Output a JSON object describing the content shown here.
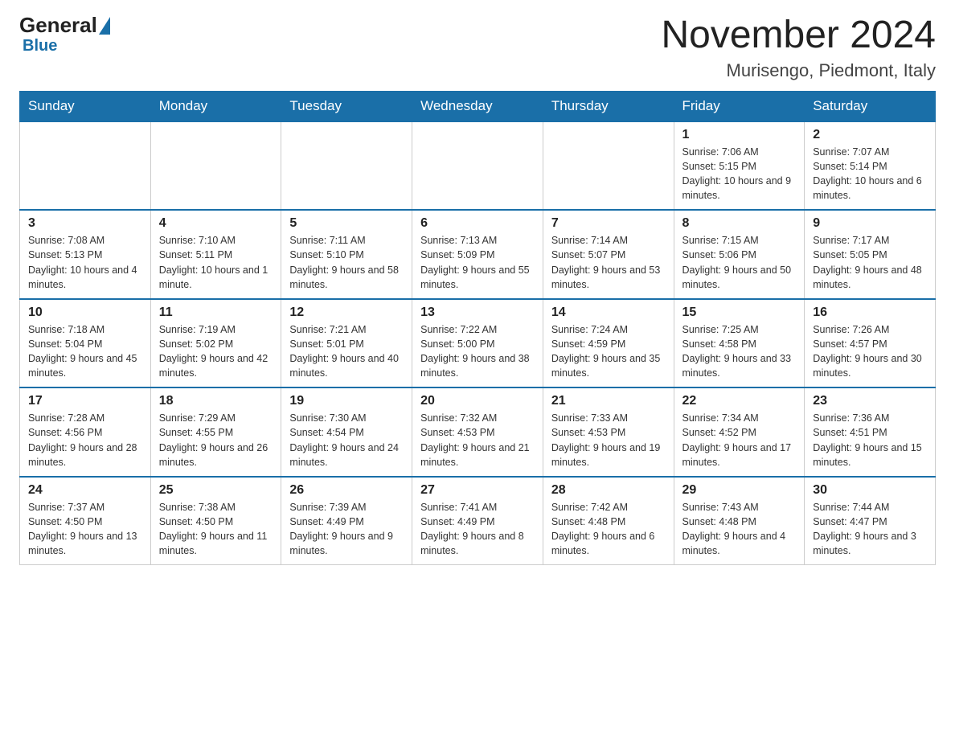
{
  "logo": {
    "general": "General",
    "blue": "Blue"
  },
  "header": {
    "title": "November 2024",
    "location": "Murisengo, Piedmont, Italy"
  },
  "weekdays": [
    "Sunday",
    "Monday",
    "Tuesday",
    "Wednesday",
    "Thursday",
    "Friday",
    "Saturday"
  ],
  "weeks": [
    [
      {
        "day": "",
        "info": ""
      },
      {
        "day": "",
        "info": ""
      },
      {
        "day": "",
        "info": ""
      },
      {
        "day": "",
        "info": ""
      },
      {
        "day": "",
        "info": ""
      },
      {
        "day": "1",
        "info": "Sunrise: 7:06 AM\nSunset: 5:15 PM\nDaylight: 10 hours and 9 minutes."
      },
      {
        "day": "2",
        "info": "Sunrise: 7:07 AM\nSunset: 5:14 PM\nDaylight: 10 hours and 6 minutes."
      }
    ],
    [
      {
        "day": "3",
        "info": "Sunrise: 7:08 AM\nSunset: 5:13 PM\nDaylight: 10 hours and 4 minutes."
      },
      {
        "day": "4",
        "info": "Sunrise: 7:10 AM\nSunset: 5:11 PM\nDaylight: 10 hours and 1 minute."
      },
      {
        "day": "5",
        "info": "Sunrise: 7:11 AM\nSunset: 5:10 PM\nDaylight: 9 hours and 58 minutes."
      },
      {
        "day": "6",
        "info": "Sunrise: 7:13 AM\nSunset: 5:09 PM\nDaylight: 9 hours and 55 minutes."
      },
      {
        "day": "7",
        "info": "Sunrise: 7:14 AM\nSunset: 5:07 PM\nDaylight: 9 hours and 53 minutes."
      },
      {
        "day": "8",
        "info": "Sunrise: 7:15 AM\nSunset: 5:06 PM\nDaylight: 9 hours and 50 minutes."
      },
      {
        "day": "9",
        "info": "Sunrise: 7:17 AM\nSunset: 5:05 PM\nDaylight: 9 hours and 48 minutes."
      }
    ],
    [
      {
        "day": "10",
        "info": "Sunrise: 7:18 AM\nSunset: 5:04 PM\nDaylight: 9 hours and 45 minutes."
      },
      {
        "day": "11",
        "info": "Sunrise: 7:19 AM\nSunset: 5:02 PM\nDaylight: 9 hours and 42 minutes."
      },
      {
        "day": "12",
        "info": "Sunrise: 7:21 AM\nSunset: 5:01 PM\nDaylight: 9 hours and 40 minutes."
      },
      {
        "day": "13",
        "info": "Sunrise: 7:22 AM\nSunset: 5:00 PM\nDaylight: 9 hours and 38 minutes."
      },
      {
        "day": "14",
        "info": "Sunrise: 7:24 AM\nSunset: 4:59 PM\nDaylight: 9 hours and 35 minutes."
      },
      {
        "day": "15",
        "info": "Sunrise: 7:25 AM\nSunset: 4:58 PM\nDaylight: 9 hours and 33 minutes."
      },
      {
        "day": "16",
        "info": "Sunrise: 7:26 AM\nSunset: 4:57 PM\nDaylight: 9 hours and 30 minutes."
      }
    ],
    [
      {
        "day": "17",
        "info": "Sunrise: 7:28 AM\nSunset: 4:56 PM\nDaylight: 9 hours and 28 minutes."
      },
      {
        "day": "18",
        "info": "Sunrise: 7:29 AM\nSunset: 4:55 PM\nDaylight: 9 hours and 26 minutes."
      },
      {
        "day": "19",
        "info": "Sunrise: 7:30 AM\nSunset: 4:54 PM\nDaylight: 9 hours and 24 minutes."
      },
      {
        "day": "20",
        "info": "Sunrise: 7:32 AM\nSunset: 4:53 PM\nDaylight: 9 hours and 21 minutes."
      },
      {
        "day": "21",
        "info": "Sunrise: 7:33 AM\nSunset: 4:53 PM\nDaylight: 9 hours and 19 minutes."
      },
      {
        "day": "22",
        "info": "Sunrise: 7:34 AM\nSunset: 4:52 PM\nDaylight: 9 hours and 17 minutes."
      },
      {
        "day": "23",
        "info": "Sunrise: 7:36 AM\nSunset: 4:51 PM\nDaylight: 9 hours and 15 minutes."
      }
    ],
    [
      {
        "day": "24",
        "info": "Sunrise: 7:37 AM\nSunset: 4:50 PM\nDaylight: 9 hours and 13 minutes."
      },
      {
        "day": "25",
        "info": "Sunrise: 7:38 AM\nSunset: 4:50 PM\nDaylight: 9 hours and 11 minutes."
      },
      {
        "day": "26",
        "info": "Sunrise: 7:39 AM\nSunset: 4:49 PM\nDaylight: 9 hours and 9 minutes."
      },
      {
        "day": "27",
        "info": "Sunrise: 7:41 AM\nSunset: 4:49 PM\nDaylight: 9 hours and 8 minutes."
      },
      {
        "day": "28",
        "info": "Sunrise: 7:42 AM\nSunset: 4:48 PM\nDaylight: 9 hours and 6 minutes."
      },
      {
        "day": "29",
        "info": "Sunrise: 7:43 AM\nSunset: 4:48 PM\nDaylight: 9 hours and 4 minutes."
      },
      {
        "day": "30",
        "info": "Sunrise: 7:44 AM\nSunset: 4:47 PM\nDaylight: 9 hours and 3 minutes."
      }
    ]
  ]
}
